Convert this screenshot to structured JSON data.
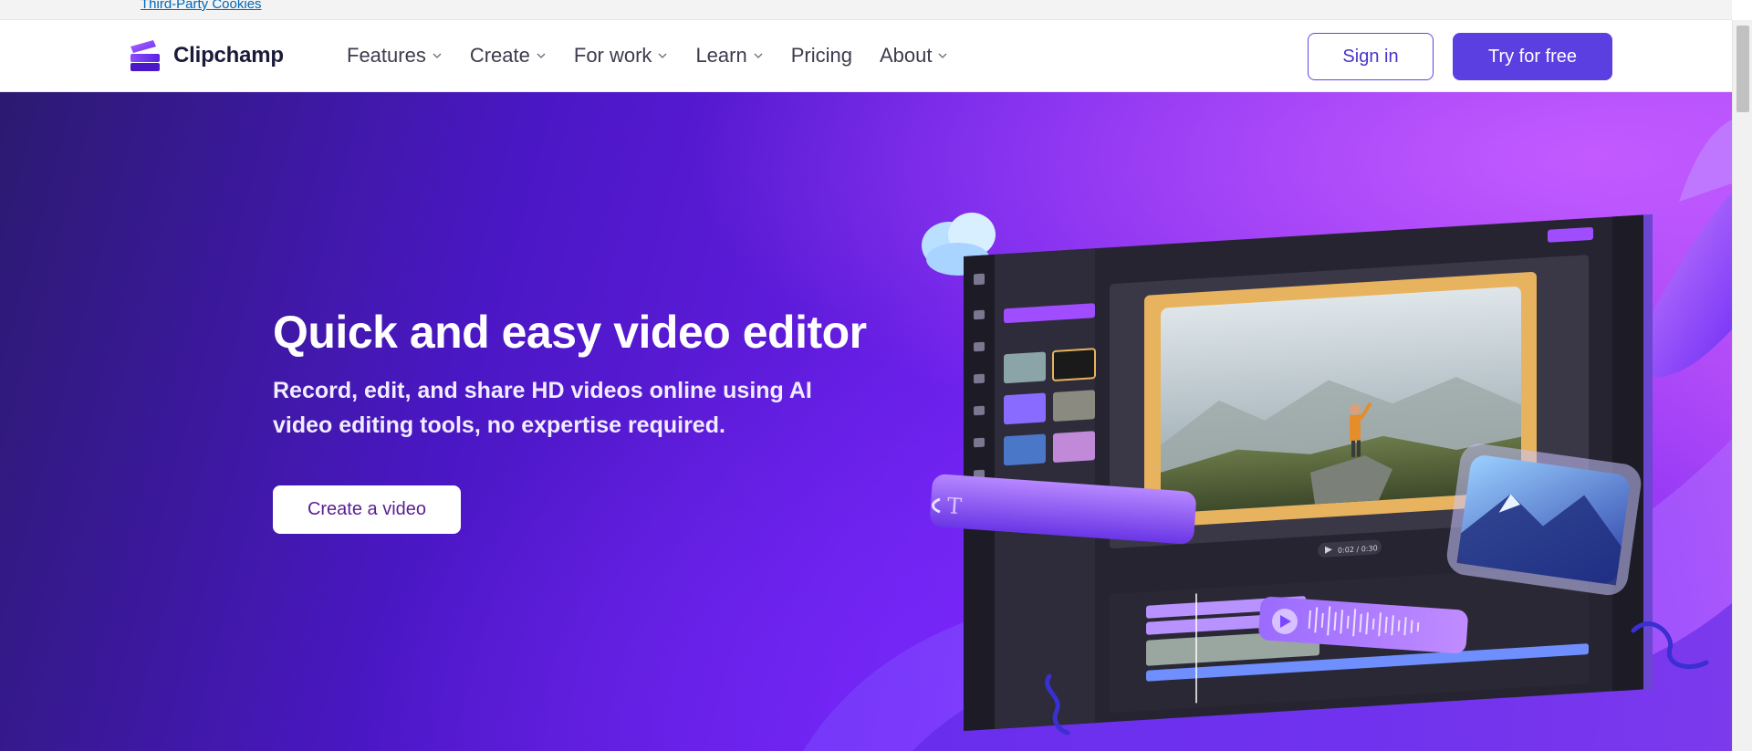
{
  "cookie_banner": {
    "link_text": "Third-Party Cookies"
  },
  "navbar": {
    "brand": "Clipchamp",
    "items": [
      {
        "label": "Features",
        "has_dropdown": true
      },
      {
        "label": "Create",
        "has_dropdown": true
      },
      {
        "label": "For work",
        "has_dropdown": true
      },
      {
        "label": "Learn",
        "has_dropdown": true
      },
      {
        "label": "Pricing",
        "has_dropdown": false
      },
      {
        "label": "About",
        "has_dropdown": true
      }
    ],
    "sign_in_label": "Sign in",
    "try_label": "Try for free"
  },
  "hero": {
    "title": "Quick and easy video editor",
    "subtitle": "Record, edit, and share HD videos online using AI video editing tools, no expertise required.",
    "cta_label": "Create a video",
    "editor_preview": {
      "timestamp": "0:02 / 0:30"
    }
  },
  "colors": {
    "brand_purple": "#5b3fe0",
    "hero_dark": "#2b1a70",
    "hero_light": "#b44df5",
    "link_blue": "#0067b8",
    "frame_orange": "#e8b35e"
  }
}
